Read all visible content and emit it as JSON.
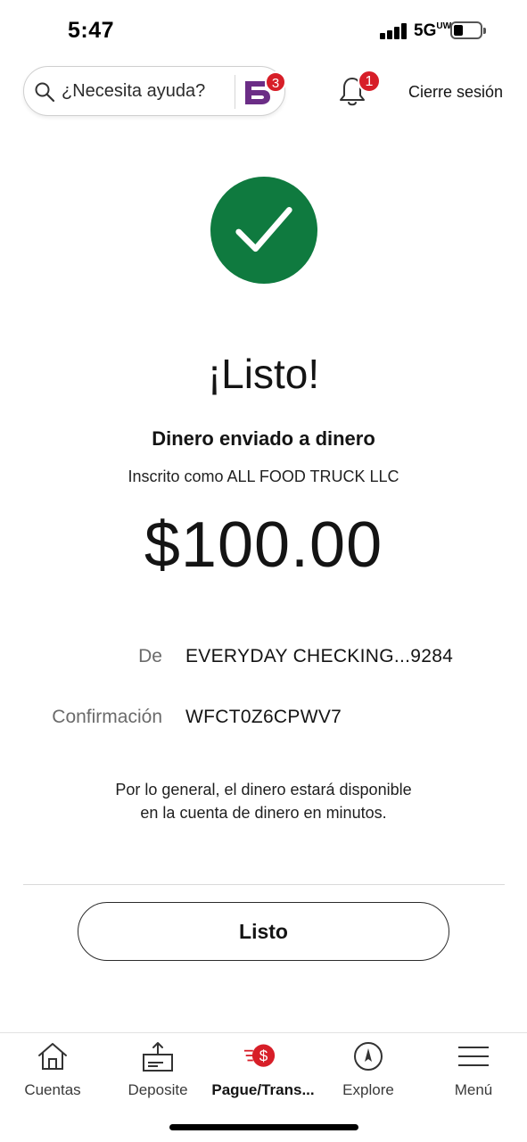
{
  "status_bar": {
    "time": "5:47",
    "network": "5G",
    "network_suffix": "UW"
  },
  "header": {
    "search_placeholder": "¿Necesita ayuda?",
    "assistant_badge": "3",
    "notification_badge": "1",
    "logout_label": "Cierre sesión"
  },
  "confirmation": {
    "heading": "¡Listo!",
    "subheading": "Dinero enviado a dinero",
    "enrolled_as": "Inscrito como ALL FOOD TRUCK LLC",
    "amount": "$100.00",
    "details": [
      {
        "label": "De",
        "value": "EVERYDAY CHECKING...9284"
      },
      {
        "label": "Confirmación",
        "value": "WFCT0Z6CPWV7"
      }
    ],
    "note_line1": "Por lo general, el dinero estará disponible",
    "note_line2": "en la cuenta de dinero en minutos.",
    "done_label": "Listo"
  },
  "tabbar": {
    "items": [
      {
        "label": "Cuentas",
        "icon": "home-icon"
      },
      {
        "label": "Deposite",
        "icon": "deposit-icon"
      },
      {
        "label": "Pague/Trans...",
        "icon": "pay-transfer-icon",
        "active": true
      },
      {
        "label": "Explore",
        "icon": "compass-icon"
      },
      {
        "label": "Menú",
        "icon": "menu-icon"
      }
    ]
  },
  "colors": {
    "success_green": "#0f7a3f",
    "badge_red": "#d71e28",
    "assistant_purple": "#6b2d86"
  }
}
